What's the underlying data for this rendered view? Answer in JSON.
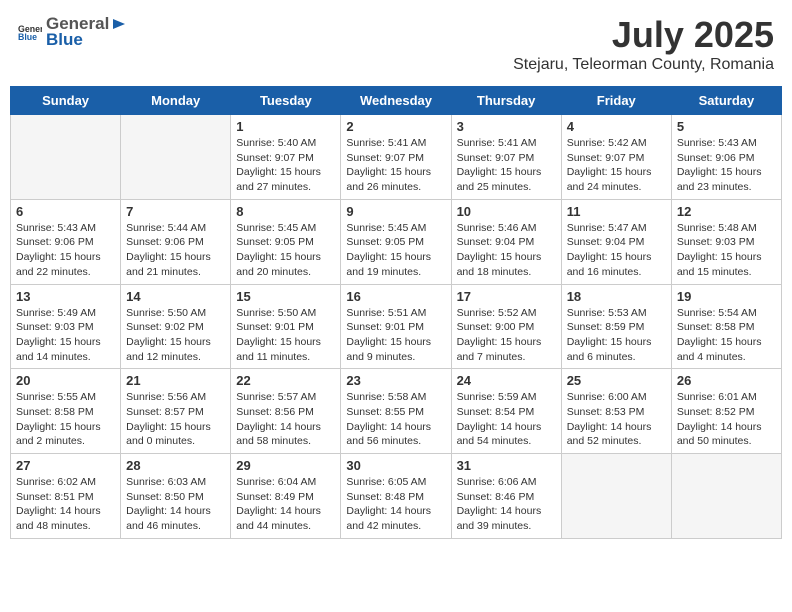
{
  "header": {
    "logo_general": "General",
    "logo_blue": "Blue",
    "month_year": "July 2025",
    "location": "Stejaru, Teleorman County, Romania"
  },
  "weekdays": [
    "Sunday",
    "Monday",
    "Tuesday",
    "Wednesday",
    "Thursday",
    "Friday",
    "Saturday"
  ],
  "weeks": [
    [
      {
        "day": "",
        "info": ""
      },
      {
        "day": "",
        "info": ""
      },
      {
        "day": "1",
        "info": "Sunrise: 5:40 AM\nSunset: 9:07 PM\nDaylight: 15 hours\nand 27 minutes."
      },
      {
        "day": "2",
        "info": "Sunrise: 5:41 AM\nSunset: 9:07 PM\nDaylight: 15 hours\nand 26 minutes."
      },
      {
        "day": "3",
        "info": "Sunrise: 5:41 AM\nSunset: 9:07 PM\nDaylight: 15 hours\nand 25 minutes."
      },
      {
        "day": "4",
        "info": "Sunrise: 5:42 AM\nSunset: 9:07 PM\nDaylight: 15 hours\nand 24 minutes."
      },
      {
        "day": "5",
        "info": "Sunrise: 5:43 AM\nSunset: 9:06 PM\nDaylight: 15 hours\nand 23 minutes."
      }
    ],
    [
      {
        "day": "6",
        "info": "Sunrise: 5:43 AM\nSunset: 9:06 PM\nDaylight: 15 hours\nand 22 minutes."
      },
      {
        "day": "7",
        "info": "Sunrise: 5:44 AM\nSunset: 9:06 PM\nDaylight: 15 hours\nand 21 minutes."
      },
      {
        "day": "8",
        "info": "Sunrise: 5:45 AM\nSunset: 9:05 PM\nDaylight: 15 hours\nand 20 minutes."
      },
      {
        "day": "9",
        "info": "Sunrise: 5:45 AM\nSunset: 9:05 PM\nDaylight: 15 hours\nand 19 minutes."
      },
      {
        "day": "10",
        "info": "Sunrise: 5:46 AM\nSunset: 9:04 PM\nDaylight: 15 hours\nand 18 minutes."
      },
      {
        "day": "11",
        "info": "Sunrise: 5:47 AM\nSunset: 9:04 PM\nDaylight: 15 hours\nand 16 minutes."
      },
      {
        "day": "12",
        "info": "Sunrise: 5:48 AM\nSunset: 9:03 PM\nDaylight: 15 hours\nand 15 minutes."
      }
    ],
    [
      {
        "day": "13",
        "info": "Sunrise: 5:49 AM\nSunset: 9:03 PM\nDaylight: 15 hours\nand 14 minutes."
      },
      {
        "day": "14",
        "info": "Sunrise: 5:50 AM\nSunset: 9:02 PM\nDaylight: 15 hours\nand 12 minutes."
      },
      {
        "day": "15",
        "info": "Sunrise: 5:50 AM\nSunset: 9:01 PM\nDaylight: 15 hours\nand 11 minutes."
      },
      {
        "day": "16",
        "info": "Sunrise: 5:51 AM\nSunset: 9:01 PM\nDaylight: 15 hours\nand 9 minutes."
      },
      {
        "day": "17",
        "info": "Sunrise: 5:52 AM\nSunset: 9:00 PM\nDaylight: 15 hours\nand 7 minutes."
      },
      {
        "day": "18",
        "info": "Sunrise: 5:53 AM\nSunset: 8:59 PM\nDaylight: 15 hours\nand 6 minutes."
      },
      {
        "day": "19",
        "info": "Sunrise: 5:54 AM\nSunset: 8:58 PM\nDaylight: 15 hours\nand 4 minutes."
      }
    ],
    [
      {
        "day": "20",
        "info": "Sunrise: 5:55 AM\nSunset: 8:58 PM\nDaylight: 15 hours\nand 2 minutes."
      },
      {
        "day": "21",
        "info": "Sunrise: 5:56 AM\nSunset: 8:57 PM\nDaylight: 15 hours\nand 0 minutes."
      },
      {
        "day": "22",
        "info": "Sunrise: 5:57 AM\nSunset: 8:56 PM\nDaylight: 14 hours\nand 58 minutes."
      },
      {
        "day": "23",
        "info": "Sunrise: 5:58 AM\nSunset: 8:55 PM\nDaylight: 14 hours\nand 56 minutes."
      },
      {
        "day": "24",
        "info": "Sunrise: 5:59 AM\nSunset: 8:54 PM\nDaylight: 14 hours\nand 54 minutes."
      },
      {
        "day": "25",
        "info": "Sunrise: 6:00 AM\nSunset: 8:53 PM\nDaylight: 14 hours\nand 52 minutes."
      },
      {
        "day": "26",
        "info": "Sunrise: 6:01 AM\nSunset: 8:52 PM\nDaylight: 14 hours\nand 50 minutes."
      }
    ],
    [
      {
        "day": "27",
        "info": "Sunrise: 6:02 AM\nSunset: 8:51 PM\nDaylight: 14 hours\nand 48 minutes."
      },
      {
        "day": "28",
        "info": "Sunrise: 6:03 AM\nSunset: 8:50 PM\nDaylight: 14 hours\nand 46 minutes."
      },
      {
        "day": "29",
        "info": "Sunrise: 6:04 AM\nSunset: 8:49 PM\nDaylight: 14 hours\nand 44 minutes."
      },
      {
        "day": "30",
        "info": "Sunrise: 6:05 AM\nSunset: 8:48 PM\nDaylight: 14 hours\nand 42 minutes."
      },
      {
        "day": "31",
        "info": "Sunrise: 6:06 AM\nSunset: 8:46 PM\nDaylight: 14 hours\nand 39 minutes."
      },
      {
        "day": "",
        "info": ""
      },
      {
        "day": "",
        "info": ""
      }
    ]
  ]
}
